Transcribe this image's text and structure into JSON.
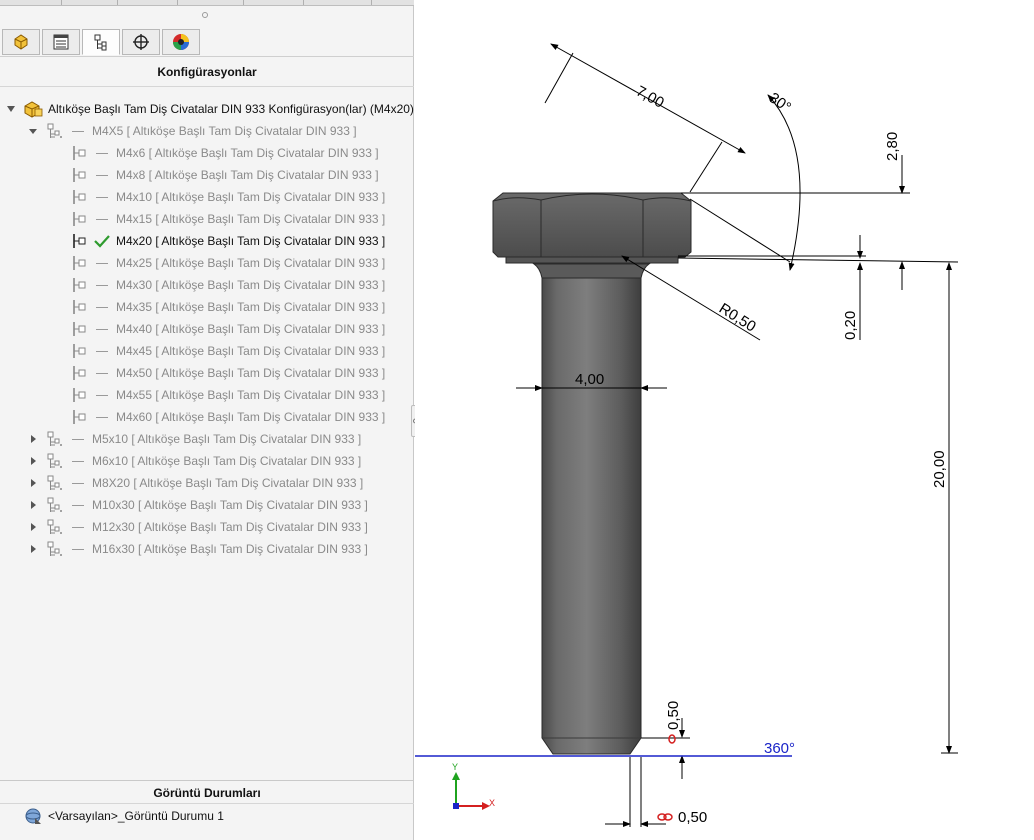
{
  "panel": {
    "title": "Konfigürasyonlar",
    "tabs": [
      {
        "name": "feature-manager-tab",
        "icon": "part-icon"
      },
      {
        "name": "property-manager-tab",
        "icon": "property-list-icon"
      },
      {
        "name": "configuration-manager-tab",
        "icon": "configuration-icon"
      },
      {
        "name": "dimxpert-manager-tab",
        "icon": "crosshair-icon"
      },
      {
        "name": "display-manager-tab",
        "icon": "color-wheel-icon"
      }
    ],
    "active_tab": 2
  },
  "tree": {
    "root": "Altıköşe Başlı Tam Diş Civatalar DIN 933 Konfigürasyon(lar)  (M4x20)",
    "parent": "M4X5 [ Altıköşe Başlı Tam Diş Civatalar DIN 933 ]",
    "children": [
      "M4x6 [ Altıköşe Başlı Tam Diş Civatalar DIN 933 ]",
      "M4x8 [ Altıköşe Başlı Tam Diş Civatalar DIN 933 ]",
      "M4x10 [ Altıköşe Başlı Tam Diş Civatalar DIN 933 ]",
      "M4x15 [ Altıköşe Başlı Tam Diş Civatalar DIN 933 ]",
      "M4x20 [ Altıköşe Başlı Tam Diş Civatalar DIN 933 ]",
      "M4x25 [ Altıköşe Başlı Tam Diş Civatalar DIN 933 ]",
      "M4x30 [ Altıköşe Başlı Tam Diş Civatalar DIN 933 ]",
      "M4x35 [ Altıköşe Başlı Tam Diş Civatalar DIN 933 ]",
      "M4x40 [ Altıköşe Başlı Tam Diş Civatalar DIN 933 ]",
      "M4x45 [ Altıköşe Başlı Tam Diş Civatalar DIN 933 ]",
      "M4x50 [ Altıköşe Başlı Tam Diş Civatalar DIN 933 ]",
      "M4x55 [ Altıköşe Başlı Tam Diş Civatalar DIN 933 ]",
      "M4x60 [ Altıköşe Başlı Tam Diş Civatalar DIN 933 ]"
    ],
    "active_child": 4,
    "siblings": [
      "M5x10 [ Altıköşe Başlı Tam Diş Civatalar DIN 933 ]",
      "M6x10 [ Altıköşe Başlı Tam Diş Civatalar DIN 933 ]",
      "M8X20 [ Altıköşe Başlı Tam Diş Civatalar DIN 933 ]",
      "M10x30 [ Altıköşe Başlı Tam Diş Civatalar DIN 933 ]",
      "M12x30 [ Altıköşe Başlı Tam Diş Civatalar DIN 933 ]",
      "M16x30 [ Altıköşe Başlı Tam Diş Civatalar DIN 933 ]"
    ]
  },
  "display_states": {
    "title": "Görüntü Durumları",
    "item": "<Varsayılan>_Görüntü Durumu 1"
  },
  "dimensions": {
    "head_width": "7,00",
    "chamfer_angle": "30°",
    "head_height": "2,80",
    "fillet_radius": "R0,50",
    "washer_face": "0,20",
    "shank_diameter": "4,00",
    "length": "20,00",
    "tip_chamfer_length": "0,50",
    "tip_chamfer_width": "0,50",
    "tip_angle": "360°"
  },
  "triad": {
    "y": "Y",
    "x": "X"
  },
  "colors": {
    "check": "#2e9b2e",
    "dim_line": "#000000",
    "ref_line": "#1a24c8",
    "bolt": "#5e5e5e"
  }
}
